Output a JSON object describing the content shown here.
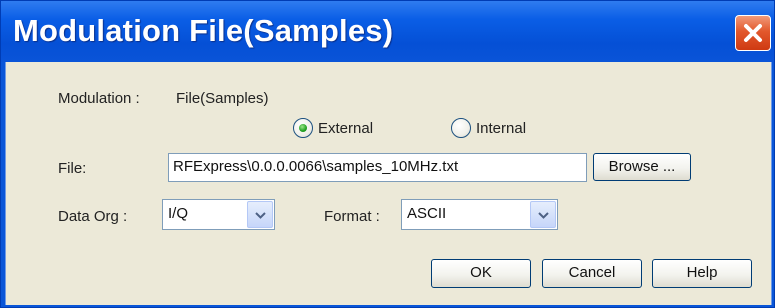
{
  "window": {
    "title": "Modulation File(Samples)"
  },
  "modulation": {
    "label": "Modulation :",
    "value": "File(Samples)"
  },
  "source": {
    "options": [
      {
        "label": "External",
        "selected": true
      },
      {
        "label": "Internal",
        "selected": false
      }
    ]
  },
  "file": {
    "label": "File:",
    "value": "RFExpress\\0.0.0.0066\\samples_10MHz.txt",
    "browse_label": "Browse ..."
  },
  "data_org": {
    "label": "Data Org :",
    "value": "I/Q"
  },
  "format": {
    "label": "Format :",
    "value": "ASCII"
  },
  "buttons": {
    "ok": "OK",
    "cancel": "Cancel",
    "help": "Help"
  },
  "icons": {
    "close": "close-icon",
    "dropdown": "chevron-down-icon"
  },
  "colors": {
    "titlebar": "#0a5ee6",
    "client": "#ece9d8",
    "close": "#e2582c",
    "radio_selected": "#21a121"
  }
}
